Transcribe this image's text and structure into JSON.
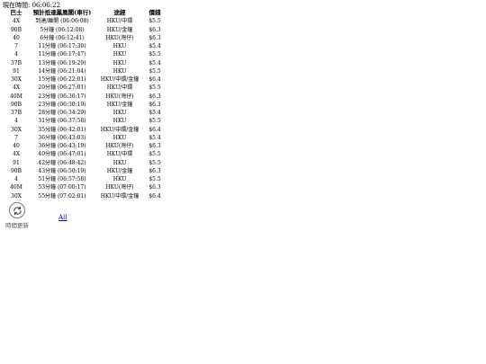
{
  "header": {
    "now_label": "現在時間: 06:06:22"
  },
  "table": {
    "headers": {
      "bus": "巴士",
      "eta": "預計抵達鳳凰閣(車行)",
      "route": "途經",
      "fare": "價錢"
    },
    "rows": [
      {
        "bus": "4X",
        "eta": "到達/離開 (06:06:08)",
        "route": "HKU/中環",
        "fare": "$5.5"
      },
      {
        "bus": "90B",
        "eta": "5分鐘 (06:12:08)",
        "route": "HKU/金鐘",
        "fare": "$6.3"
      },
      {
        "bus": "40",
        "eta": "6分鐘 (06:12:41)",
        "route": "HKU(灣仔)",
        "fare": "$6.3"
      },
      {
        "bus": "7",
        "eta": "11分鐘 (06:17:30)",
        "route": "HKU",
        "fare": "$5.4"
      },
      {
        "bus": "4",
        "eta": "11分鐘 (06:17:47)",
        "route": "HKU",
        "fare": "$5.5"
      },
      {
        "bus": "37B",
        "eta": "13分鐘 (06:19:29)",
        "route": "HKU",
        "fare": "$5.4"
      },
      {
        "bus": "91",
        "eta": "14分鐘 (06:21:04)",
        "route": "HKU",
        "fare": "$5.5"
      },
      {
        "bus": "30X",
        "eta": "15分鐘 (06:22:01)",
        "route": "HKU/中環/金鐘",
        "fare": "$6.4"
      },
      {
        "bus": "4X",
        "eta": "20分鐘 (06:27:01)",
        "route": "HKU/中環",
        "fare": "$5.5"
      },
      {
        "bus": "40M",
        "eta": "23分鐘 (06:30:17)",
        "route": "HKU(灣仔)",
        "fare": "$6.3"
      },
      {
        "bus": "90B",
        "eta": "23分鐘 (06:30:19)",
        "route": "HKU/金鐘",
        "fare": "$6.3"
      },
      {
        "bus": "37B",
        "eta": "28分鐘 (06:34:29)",
        "route": "HKU",
        "fare": "$5.4"
      },
      {
        "bus": "4",
        "eta": "31分鐘 (06:37:58)",
        "route": "HKU",
        "fare": "$5.5"
      },
      {
        "bus": "30X",
        "eta": "35分鐘 (06:42:01)",
        "route": "HKU/中環/金鐘",
        "fare": "$6.4"
      },
      {
        "bus": "7",
        "eta": "36分鐘 (06:43:03)",
        "route": "HKU",
        "fare": "$5.4"
      },
      {
        "bus": "40",
        "eta": "36分鐘 (06:43:19)",
        "route": "HKU(灣仔)",
        "fare": "$6.3"
      },
      {
        "bus": "4X",
        "eta": "40分鐘 (06:47:01)",
        "route": "HKU/中環",
        "fare": "$5.5"
      },
      {
        "bus": "91",
        "eta": "42分鐘 (06:48:42)",
        "route": "HKU",
        "fare": "$5.5"
      },
      {
        "bus": "90B",
        "eta": "43分鐘 (06:50:19)",
        "route": "HKU/金鐘",
        "fare": "$6.3"
      },
      {
        "bus": "4",
        "eta": "51分鐘 (06:57:58)",
        "route": "HKU",
        "fare": "$5.5"
      },
      {
        "bus": "40M",
        "eta": "53分鐘 (07:00:17)",
        "route": "HKU(灣仔)",
        "fare": "$6.3"
      },
      {
        "bus": "30X",
        "eta": "55分鐘 (07:02:01)",
        "route": "HKU/中環/金鐘",
        "fare": "$6.4"
      }
    ]
  },
  "refresh": {
    "icon": "refresh-icon",
    "label": "時間更新"
  },
  "links": {
    "all_label": "All"
  },
  "colors": {
    "link": "#0000ee",
    "icon_stroke": "#3a3a3a",
    "icon_border": "#7a7a7a"
  }
}
